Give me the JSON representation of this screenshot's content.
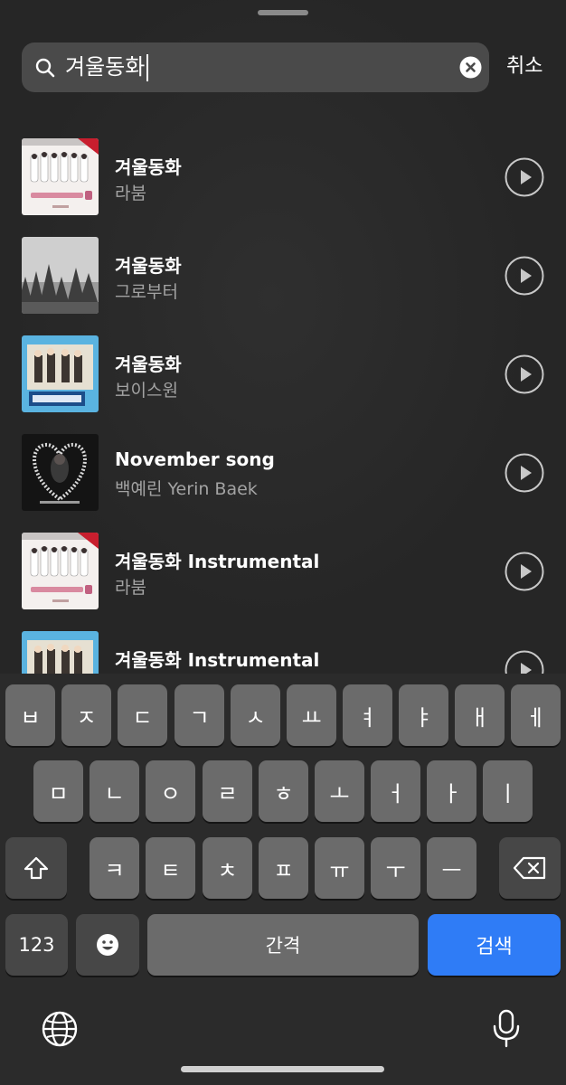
{
  "search": {
    "query": "겨울동화",
    "cancel_label": "취소"
  },
  "results": [
    {
      "title": "겨울동화",
      "artist": "라붐",
      "art": "winter-story"
    },
    {
      "title": "겨울동화",
      "artist": "그로부터",
      "art": "snow-trees"
    },
    {
      "title": "겨울동화",
      "artist": "보이스원",
      "art": "voiceone"
    },
    {
      "title": "November song",
      "artist": "백예린 Yerin Baek",
      "art": "heart-frame"
    },
    {
      "title": "겨울동화 Instrumental",
      "artist": "라붐",
      "art": "winter-story"
    },
    {
      "title": "겨울동화 Instrumental",
      "artist": "",
      "art": "voiceone"
    }
  ],
  "keyboard": {
    "row1": [
      "ㅂ",
      "ㅈ",
      "ㄷ",
      "ㄱ",
      "ㅅ",
      "ㅛ",
      "ㅕ",
      "ㅑ",
      "ㅐ",
      "ㅔ"
    ],
    "row2": [
      "ㅁ",
      "ㄴ",
      "ㅇ",
      "ㄹ",
      "ㅎ",
      "ㅗ",
      "ㅓ",
      "ㅏ",
      "ㅣ"
    ],
    "row3": [
      "ㅋ",
      "ㅌ",
      "ㅊ",
      "ㅍ",
      "ㅠ",
      "ㅜ",
      "ㅡ"
    ],
    "numbers_label": "123",
    "space_label": "간격",
    "search_label": "검색",
    "icons": {
      "shift": "shift-icon",
      "delete": "delete-icon",
      "emoji": "emoji-icon",
      "globe": "globe-icon",
      "mic": "mic-icon"
    }
  },
  "colors": {
    "accent": "#2f7cf6",
    "background": "#262626",
    "key": "#6b6b6b",
    "key_dark": "#474747"
  }
}
